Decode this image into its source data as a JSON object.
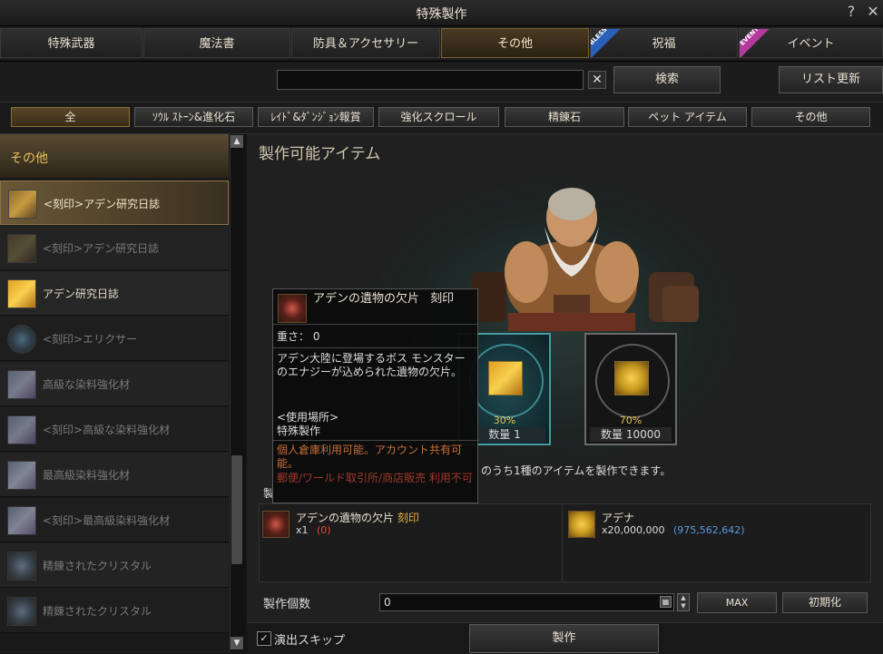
{
  "window": {
    "title": "特殊製作",
    "help_label": "?",
    "close_label": "✕"
  },
  "tabs": [
    {
      "label": "特殊武器",
      "active": false
    },
    {
      "label": "魔法書",
      "active": false
    },
    {
      "label": "防具＆アクセサリー",
      "active": false
    },
    {
      "label": "その他",
      "active": true
    },
    {
      "label": "祝福",
      "active": false,
      "ribbon": "BLESS",
      "ribbon_color": "#2b5fb8"
    },
    {
      "label": "イベント",
      "active": false,
      "ribbon": "EVENT",
      "ribbon_color": "#b33a9a"
    }
  ],
  "search": {
    "value": "",
    "clear_label": "✕",
    "button_label": "検索"
  },
  "refresh_label": "リスト更新",
  "filters": [
    {
      "label": "全",
      "active": true
    },
    {
      "label": "ｿｳﾙ ｽﾄｰﾝ&進化石",
      "active": false
    },
    {
      "label": "ﾚｲﾄﾞ&ﾀﾞﾝｼﾞｮﾝ報賞",
      "active": false
    },
    {
      "label": "強化スクロール",
      "active": false
    },
    {
      "label": "精錬石",
      "active": false
    },
    {
      "label": "ペット アイテム",
      "active": false
    },
    {
      "label": "その他",
      "active": false
    }
  ],
  "sidebar": {
    "header": "その他",
    "items": [
      {
        "label": "<刻印>アデン研究日誌",
        "state": "selected",
        "icon": "scroll-icon"
      },
      {
        "label": "<刻印>アデン研究日誌",
        "state": "dim",
        "icon": "scroll-icon"
      },
      {
        "label": "アデン研究日誌",
        "state": "normal",
        "icon": "scroll-icon"
      },
      {
        "label": "<刻印>エリクサー",
        "state": "dim",
        "icon": "elixir-icon"
      },
      {
        "label": "高級な染料強化材",
        "state": "dim",
        "icon": "dye-icon"
      },
      {
        "label": "<刻印>高級な染料強化材",
        "state": "dim",
        "icon": "dye-icon"
      },
      {
        "label": "最高級染料強化材",
        "state": "dim",
        "icon": "dye-icon"
      },
      {
        "label": "<刻印>最高級染料強化材",
        "state": "dim",
        "icon": "dye-icon"
      },
      {
        "label": "精錬されたクリスタル",
        "state": "dim",
        "icon": "crystal-icon"
      },
      {
        "label": "精錬されたクリスタル",
        "state": "dim",
        "icon": "crystal-icon"
      }
    ]
  },
  "main": {
    "title": "製作可能アイテム",
    "results": [
      {
        "percent": "30%",
        "qty": "数量 1",
        "icon": "scroll-icon"
      },
      {
        "percent": "70%",
        "qty": "数量 10000",
        "icon": "adena-icon"
      }
    ],
    "note": "のうち1種のアイテムを製作できます。",
    "materials_label": "製",
    "materials": [
      {
        "name": "アデンの遺物の欠片",
        "tag": "刻印",
        "qty": "x1",
        "owned": "(0)",
        "icon": "relic-shard-icon"
      },
      {
        "name": "アデナ",
        "qty": "x20,000,000",
        "owned": "(975,562,642)",
        "icon": "adena-icon"
      }
    ],
    "count_label": "製作個数",
    "count_value": "0",
    "max_label": "MAX",
    "reset_label": "初期化",
    "skip_label": "演出スキップ",
    "skip_checked": true,
    "craft_label": "製作"
  },
  "tooltip": {
    "name": "アデンの遺物の欠片",
    "tag": "刻印",
    "weight": "重さ： 0",
    "desc": "アデン大陸に登場するボス モンスターのエナジーが込められた遺物の欠片。",
    "usage_heading": "<使用場所>",
    "usage": "特殊製作",
    "storage": "個人倉庫利用可能。アカウント共有可能。",
    "restriction": "郵便/ワールド取引所/商店販売 利用不可"
  }
}
